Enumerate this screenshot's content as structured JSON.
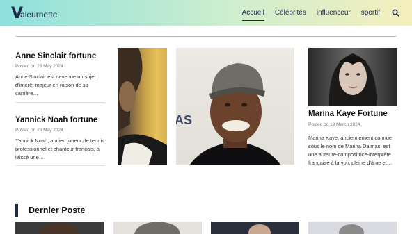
{
  "header": {
    "logo_letter": "V",
    "logo_text": "aleurnette",
    "nav": [
      {
        "label": "Accueil",
        "active": true
      },
      {
        "label": "Célébrités",
        "active": false
      },
      {
        "label": "influenceur",
        "active": false
      },
      {
        "label": "sportif",
        "active": false
      }
    ]
  },
  "posts": [
    {
      "title": "Anne Sinclair fortune",
      "date": "Posted on 23 May 2024",
      "excerpt": "Anne Sinclair est devenue un sujet d'intérêt majeur en raison de sa carrière…"
    },
    {
      "title": "Yannick Noah fortune",
      "date": "Posted on 23 May 2024",
      "excerpt": "Yannick Noah, ancien joueur de tennis professionnel et chanteur français, a laissé une…"
    }
  ],
  "feature": {
    "title": "Marina Kaye Fortune",
    "date": "Posted on 19 March 2024",
    "excerpt": "Marina Kaye, anciennement connue sous le nom de Marina Dalmas, est une auteure-compositrice-interprète française à la voix pleine d'âme et…"
  },
  "photo_center_text": "AS",
  "section": {
    "title": "Dernier Poste"
  },
  "colors": {
    "accent": "#1f2a44",
    "header_gradient_start": "#8ee0dc",
    "header_gradient_end": "#f5efbd"
  }
}
